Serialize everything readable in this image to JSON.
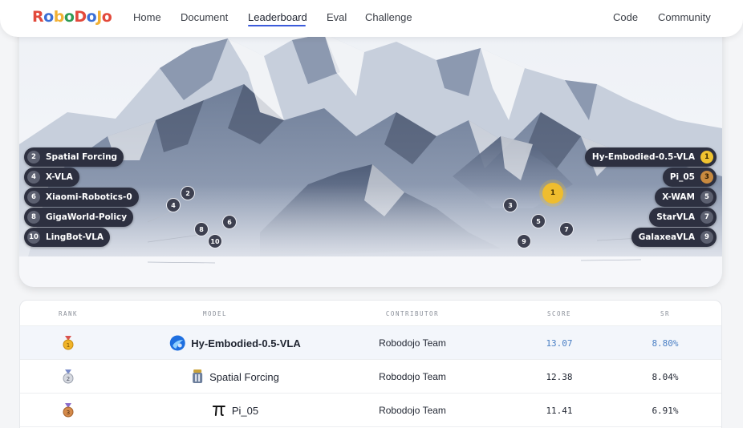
{
  "brand": {
    "letters": [
      {
        "ch": "R",
        "color": "#e2493b"
      },
      {
        "ch": "o",
        "color": "#3b6fd6"
      },
      {
        "ch": "b",
        "color": "#f2b134"
      },
      {
        "ch": "o",
        "color": "#2e9b55"
      },
      {
        "ch": "D",
        "color": "#e2493b"
      },
      {
        "ch": "o",
        "color": "#3b6fd6"
      },
      {
        "ch": "J",
        "color": "#f2b134"
      },
      {
        "ch": "o",
        "color": "#e2493b"
      }
    ]
  },
  "nav": {
    "left": [
      "Home",
      "Document",
      "Leaderboard",
      "Eval",
      "Challenge"
    ],
    "right": [
      "Code",
      "Community"
    ],
    "active": "Leaderboard"
  },
  "hero": {
    "left_labels": [
      {
        "rank": "2",
        "name": "Spatial Forcing"
      },
      {
        "rank": "4",
        "name": "X-VLA"
      },
      {
        "rank": "6",
        "name": "Xiaomi-Robotics-0"
      },
      {
        "rank": "8",
        "name": "GigaWorld-Policy"
      },
      {
        "rank": "10",
        "name": "LingBot-VLA"
      }
    ],
    "right_labels": [
      {
        "rank": "1",
        "name": "Hy-Embodied-0.5-VLA",
        "medal": "gold"
      },
      {
        "rank": "3",
        "name": "Pi_05",
        "medal": "bronze"
      },
      {
        "rank": "5",
        "name": "X-WAM"
      },
      {
        "rank": "7",
        "name": "StarVLA"
      },
      {
        "rank": "9",
        "name": "GalaxeaVLA"
      }
    ],
    "markers": [
      "1",
      "2",
      "3",
      "4",
      "5",
      "6",
      "7",
      "8",
      "9",
      "10"
    ]
  },
  "table": {
    "headers": [
      "RANK",
      "MODEL",
      "CONTRIBUTOR",
      "SCORE",
      "SR"
    ],
    "rows": [
      {
        "rank": "1",
        "medal": "gold-medal-icon",
        "model": "Hy-Embodied-0.5-VLA",
        "logo": "hy-embodied-logo-icon",
        "contributor": "Robodojo Team",
        "score": "13.07",
        "sr": "8.80%"
      },
      {
        "rank": "2",
        "medal": "silver-medal-icon",
        "model": "Spatial Forcing",
        "logo": "spatial-forcing-logo-icon",
        "contributor": "Robodojo Team",
        "score": "12.38",
        "sr": "8.04%"
      },
      {
        "rank": "3",
        "medal": "bronze-medal-icon",
        "model": "Pi_05",
        "logo": "pi-logo-icon",
        "contributor": "Robodojo Team",
        "score": "11.41",
        "sr": "6.91%"
      }
    ]
  },
  "colors": {
    "accent": "#3b5bdb",
    "highlight_text": "#4a7fc4",
    "pill_bg": "#2d3040",
    "gold": "#f0c330",
    "bronze": "#c88a3f"
  }
}
